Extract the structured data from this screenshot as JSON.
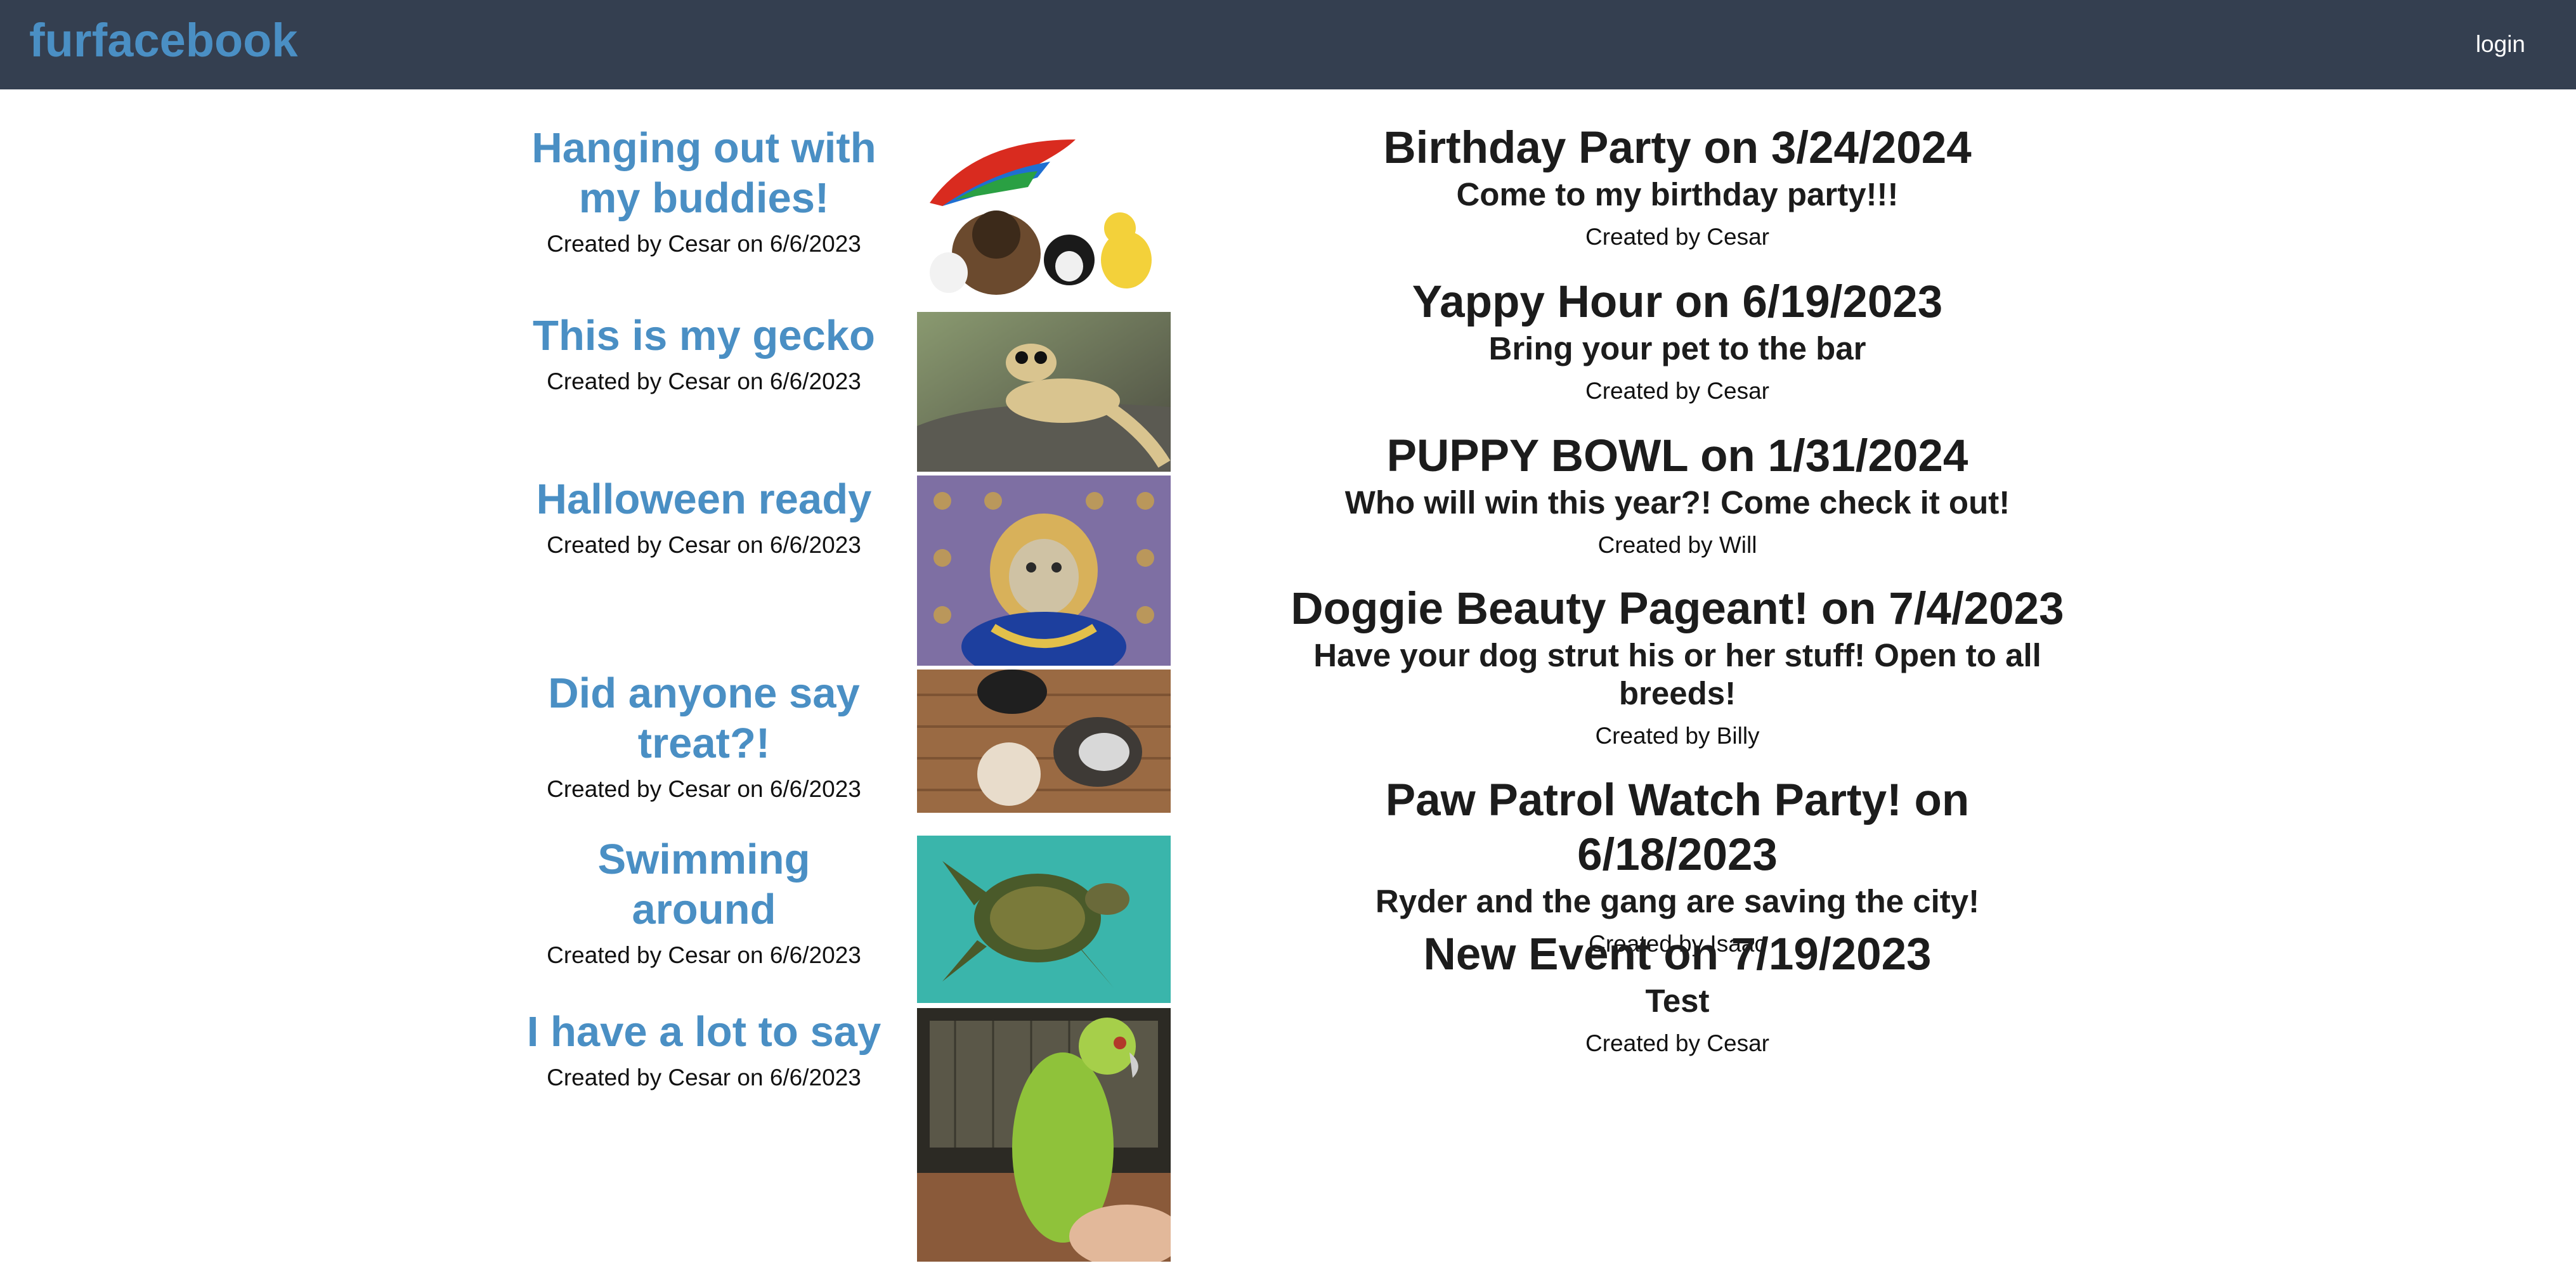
{
  "nav": {
    "brand": "furfacebook",
    "login": "login"
  },
  "posts": [
    {
      "title": "Hanging out with my buddies!",
      "meta": "Created by Cesar on 6/6/2023",
      "image": "parrot-dog-kittens-duckling-photo"
    },
    {
      "title": "This is my gecko",
      "meta": "Created by Cesar on 6/6/2023",
      "image": "gecko-photo"
    },
    {
      "title": "Halloween ready",
      "meta": "Created by Cesar on 6/6/2023",
      "image": "cat-costume-photo"
    },
    {
      "title": "Did anyone say treat?!",
      "meta": "Created by Cesar on 6/6/2023",
      "image": "three-dogs-photo"
    },
    {
      "title": "Swimming around",
      "meta": "Created by Cesar on 6/6/2023",
      "image": "sea-turtle-photo"
    },
    {
      "title": "I have a lot to say",
      "meta": "Created by Cesar on 6/6/2023",
      "image": "green-parrot-photo"
    }
  ],
  "events": [
    {
      "title": "Birthday Party on 3/24/2024",
      "desc": "Come to my birthday party!!!",
      "meta": "Created by Cesar"
    },
    {
      "title": "Yappy Hour on 6/19/2023",
      "desc": "Bring your pet to the bar",
      "meta": "Created by Cesar"
    },
    {
      "title": "PUPPY BOWL on 1/31/2024",
      "desc": "Who will win this year?! Come check it out!",
      "meta": "Created by Will"
    },
    {
      "title": "Doggie Beauty Pageant! on 7/4/2023",
      "desc": "Have your dog strut his or her stuff! Open to all breeds!",
      "meta": "Created by Billy"
    },
    {
      "title": "Paw Patrol Watch Party! on 6/18/2023",
      "desc": "Ryder and the gang are saving the city!",
      "meta": "Created by Isaac"
    },
    {
      "title": "New Event on 7/19/2023",
      "desc": "Test",
      "meta": "Created by Cesar"
    }
  ],
  "colors": {
    "navbar": "#343f50",
    "brand": "#4a8fc4",
    "post_title": "#4a8fc4"
  }
}
